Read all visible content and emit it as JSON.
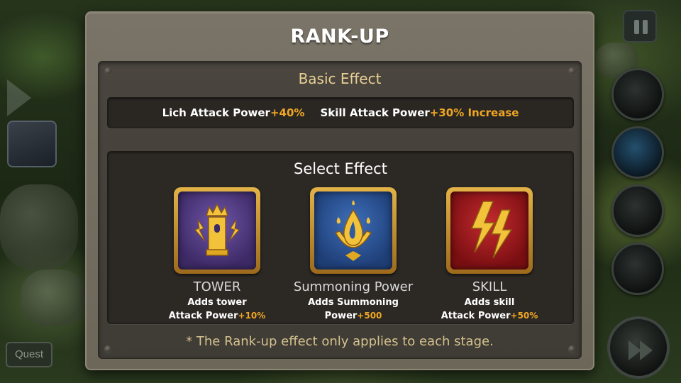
{
  "dialog": {
    "title": "RANK-UP",
    "basic_effect": {
      "heading": "Basic Effect",
      "items": [
        {
          "label": "Lich Attack Power",
          "value": "+40%"
        },
        {
          "label": "Skill Attack Power",
          "value": "+30% Increase"
        }
      ]
    },
    "select_effect": {
      "heading": "Select Effect",
      "options": [
        {
          "title": "TOWER",
          "desc_line1": "Adds tower",
          "desc_line2": "Attack Power",
          "bonus": "+10%",
          "icon": "tower-icon",
          "color": "#5b3f8f"
        },
        {
          "title": "Summoning Power",
          "desc_line1": "Adds Summoning",
          "desc_line2": "Power",
          "bonus": "+500",
          "icon": "summoning-drop-icon",
          "color": "#2f5a9e"
        },
        {
          "title": "SKILL",
          "desc_line1": "Adds skill",
          "desc_line2": "Attack Power",
          "bonus": "+50%",
          "icon": "lightning-icon",
          "color": "#a3161b"
        }
      ]
    },
    "footnote": "* The Rank-up effect only applies to each stage."
  },
  "hud": {
    "quest_label": "Quest"
  },
  "colors": {
    "accent_orange": "#f0a623",
    "heading_gold": "#e8cf93",
    "dialog_bg": "#736d60",
    "panel_bg": "#433f39"
  }
}
